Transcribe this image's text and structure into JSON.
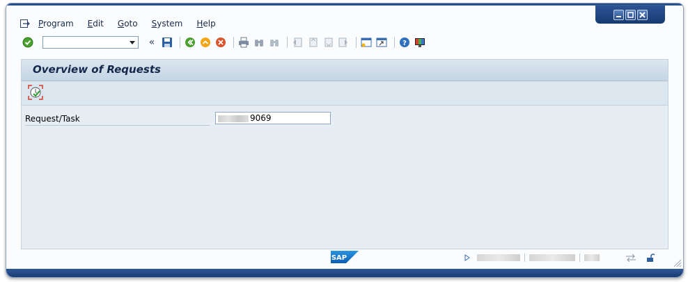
{
  "window": {
    "controls": [
      "minimize",
      "maximize",
      "close"
    ]
  },
  "menubar": {
    "items": [
      {
        "label": "Program",
        "mnemonic": "P",
        "rest": "rogram"
      },
      {
        "label": "Edit",
        "mnemonic": "E",
        "rest": "dit"
      },
      {
        "label": "Goto",
        "mnemonic": "G",
        "rest": "oto"
      },
      {
        "label": "System",
        "mnemonic": "S",
        "rest": "ystem"
      },
      {
        "label": "Help",
        "mnemonic": "H",
        "rest": "elp"
      }
    ]
  },
  "toolbar": {
    "command_field_value": "",
    "history_label": "«"
  },
  "screen": {
    "title": "Overview of Requests",
    "field_label": "Request/Task",
    "field_value_visible": "9069"
  },
  "statusbar": {
    "logo_text": "SAP"
  },
  "colors": {
    "title_text": "#14284c",
    "frame_blue": "#2d5394",
    "content_bg": "#e6edf3"
  }
}
